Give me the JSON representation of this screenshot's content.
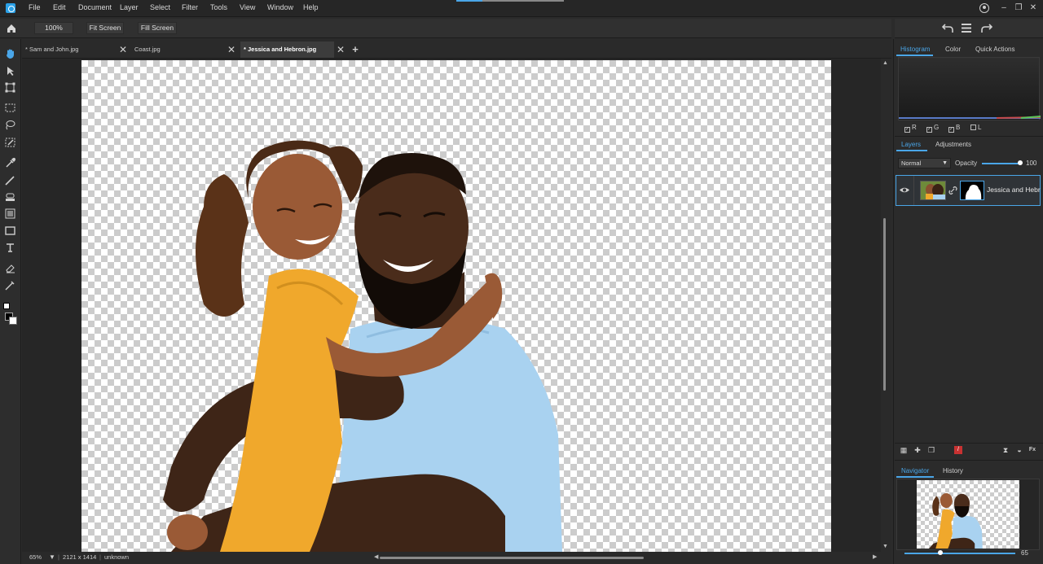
{
  "menu": [
    "File",
    "Edit",
    "Document",
    "Layer",
    "Select",
    "Filter",
    "Tools",
    "View",
    "Window",
    "Help"
  ],
  "toolbar": {
    "zoom": "100%",
    "fit_screen": "Fit Screen",
    "fill_screen": "Fill Screen"
  },
  "tabs": [
    {
      "label": "* Sam and John.jpg",
      "active": false
    },
    {
      "label": "Coast.jpg",
      "active": false
    },
    {
      "label": "* Jessica and Hebron.jpg",
      "active": true
    }
  ],
  "add_tab": "+",
  "status": {
    "zoom": "65%",
    "dimensions": "2121 x 1414",
    "info": "unknown"
  },
  "panels": {
    "top_tabs": [
      "Histogram",
      "Color",
      "Quick Actions"
    ],
    "channels": [
      "R",
      "G",
      "B",
      "L"
    ],
    "channel_checked": [
      true,
      true,
      true,
      false
    ],
    "layer_tabs": [
      "Layers",
      "Adjustments"
    ],
    "blend_mode": "Normal",
    "opacity_label": "Opacity",
    "opacity_value": "100",
    "layer_name": "Jessica and Hebron",
    "nav_tabs": [
      "Navigator",
      "History"
    ],
    "nav_zoom": "65"
  },
  "colors": {
    "accent": "#4aa6e8",
    "panel": "#2b2b2b",
    "canvas_bg": "#262626"
  }
}
